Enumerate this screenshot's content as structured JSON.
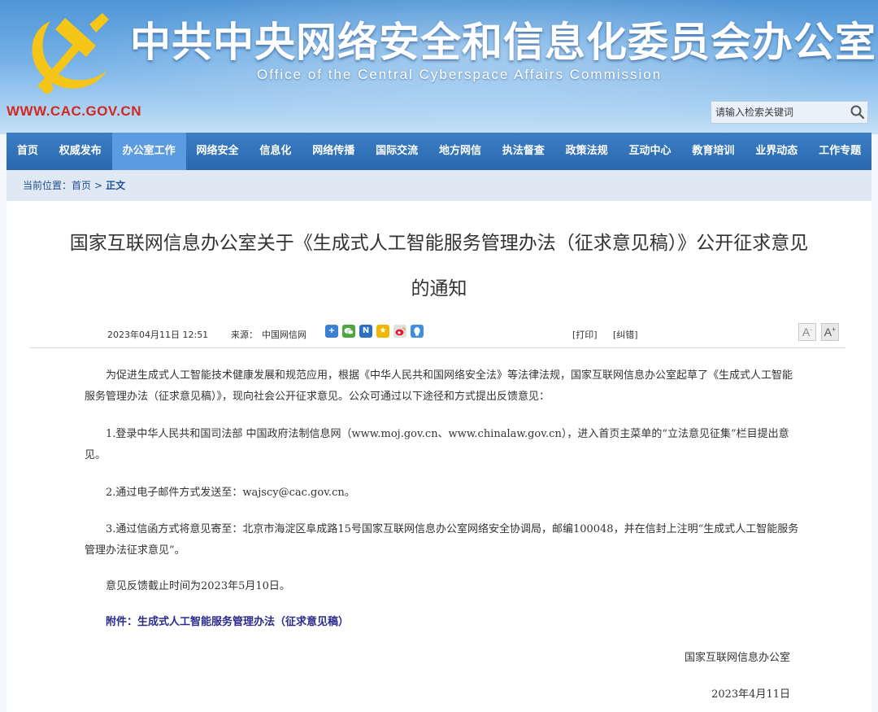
{
  "header": {
    "title_cn": "中共中央网络安全和信息化委员会办公室",
    "title_en": "Office of the Central Cyberspace Affairs Commission",
    "domain": "WWW.CAC.GOV.CN",
    "search": {
      "placeholder": "请输入检索关键词",
      "icon": "search-icon"
    }
  },
  "nav": {
    "items": [
      {
        "label": "首页"
      },
      {
        "label": "权威发布"
      },
      {
        "label": "办公室工作",
        "active": true
      },
      {
        "label": "网络安全"
      },
      {
        "label": "信息化"
      },
      {
        "label": "网络传播"
      },
      {
        "label": "国际交流"
      },
      {
        "label": "地方网信"
      },
      {
        "label": "执法督查"
      },
      {
        "label": "政策法规"
      },
      {
        "label": "互动中心"
      },
      {
        "label": "教育培训"
      },
      {
        "label": "业界动态"
      },
      {
        "label": "工作专题"
      }
    ]
  },
  "breadcrumb": {
    "prefix": "当前位置：",
    "home": "首页",
    "separator": ">",
    "current": "正文"
  },
  "article": {
    "title_line1": "国家互联网信息办公室关于《生成式人工智能服务管理办法（征求意见稿）》公开征求意见",
    "title_line2": "的通知",
    "date": "2023年04月11日 12:51",
    "source_label": "来源：",
    "source": "中国网信网",
    "share_icons": [
      "plus-share-icon",
      "wechat-icon",
      "sina-n-icon",
      "qzone-icon",
      "weibo-icon",
      "qq-icon"
    ],
    "print_label": "[打印]",
    "correct_label": "[纠错]",
    "font_minus": "A-",
    "font_plus": "A+",
    "paragraphs": {
      "p1": "为促进生成式人工智能技术健康发展和规范应用，根据《中华人民共和国网络安全法》等法律法规，国家互联网信息办公室起草了《生成式人工智能服务管理办法（征求意见稿）》，现向社会公开征求意见。公众可通过以下途径和方式提出反馈意见：",
      "p2": "1.登录中华人民共和国司法部 中国政府法制信息网（www.moj.gov.cn、www.chinalaw.gov.cn），进入首页主菜单的“立法意见征集”栏目提出意见。",
      "p3": "2.通过电子邮件方式发送至：wajscy@cac.gov.cn。",
      "p4": "3.通过信函方式将意见寄至：北京市海淀区阜成路15号国家互联网信息办公室网络安全协调局，邮编100048，并在信封上注明“生成式人工智能服务管理办法征求意见”。",
      "p5": "意见反馈截止时间为2023年5月10日。"
    },
    "attachment": "附件：生成式人工智能服务管理办法（征求意见稿）",
    "signature_org": "国家互联网信息办公室",
    "signature_date": "2023年4月11日"
  },
  "colors": {
    "nav_bg": "#2a68ad",
    "nav_active": "#5b9be0",
    "domain_red": "#d2281e",
    "emblem_gold": "#f5c518",
    "attachment_blue": "#2b2a8c"
  }
}
